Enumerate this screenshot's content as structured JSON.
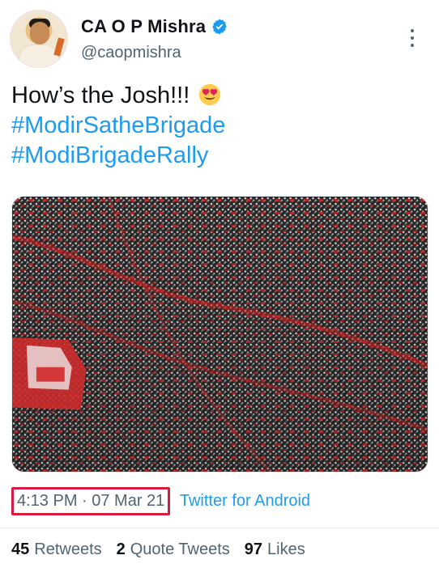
{
  "tweet": {
    "author": {
      "display_name": "CA O P Mishra",
      "handle": "@caopmishra"
    },
    "text": {
      "line1": "How’s the Josh!!!",
      "hashtag1": "#ModirSatheBrigade",
      "hashtag2": "#ModiBrigadeRally"
    },
    "timestamp": "4:13 PM · 07 Mar 21",
    "source": "Twitter for Android",
    "stats": {
      "retweets_count": "45",
      "retweets_label": "Retweets",
      "quotes_count": "2",
      "quotes_label": "Quote Tweets",
      "likes_count": "97",
      "likes_label": "Likes"
    }
  },
  "colors": {
    "link": "#1d9bf0",
    "highlight_border": "#d81b43",
    "muted": "#536471"
  },
  "icons": {
    "verified": "verified-badge-icon",
    "emoji": "heart-eyes-emoji-icon",
    "more": "more-vertical-icon"
  }
}
